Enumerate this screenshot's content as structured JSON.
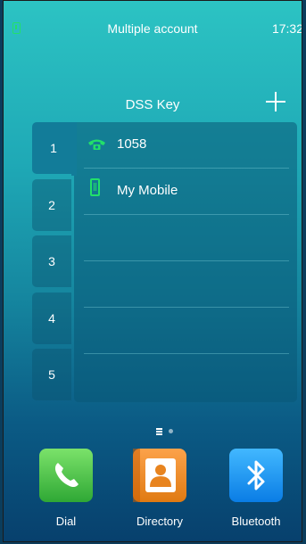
{
  "statusbar": {
    "title": "Multiple account",
    "time": "17:32"
  },
  "dss": {
    "header": "DSS Key",
    "tabs": [
      "1",
      "2",
      "3",
      "4",
      "5"
    ],
    "active_tab": "1",
    "rows": [
      {
        "label": "1058",
        "icon": "phone-icon"
      },
      {
        "label": "My Mobile",
        "icon": "mobile-icon"
      },
      {
        "label": "",
        "icon": ""
      },
      {
        "label": "",
        "icon": ""
      },
      {
        "label": "",
        "icon": ""
      }
    ]
  },
  "pager": {
    "current_page": 1,
    "total_pages": 2
  },
  "dock": {
    "dial_label": "Dial",
    "directory_label": "Directory",
    "bluetooth_label": "Bluetooth"
  },
  "colors": {
    "accent_green": "#22e06a",
    "panel": "#127c99"
  }
}
